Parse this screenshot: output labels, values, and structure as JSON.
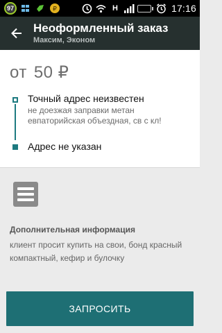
{
  "status_bar": {
    "badge": "97",
    "network_label": "H",
    "time": "17:16"
  },
  "toolbar": {
    "title": "Неоформленный заказ",
    "subtitle": "Максим, Эконом"
  },
  "order": {
    "price_prefix": "от",
    "price_value": "50 ₽",
    "pickup": {
      "title": "Точный адрес неизвестен",
      "note": "не доезжая заправки метан евпаторийская объездная, св с кл!"
    },
    "destination": {
      "title": "Адрес не указан"
    }
  },
  "additional_info": {
    "title": "Дополнительная информация",
    "text": "клиент просит купить на свои, бонд красный компактный, кефир и булочку"
  },
  "actions": {
    "request_label": "ЗАПРОСИТЬ"
  },
  "colors": {
    "accent": "#1e6f74",
    "toolbar": "#26302f"
  }
}
